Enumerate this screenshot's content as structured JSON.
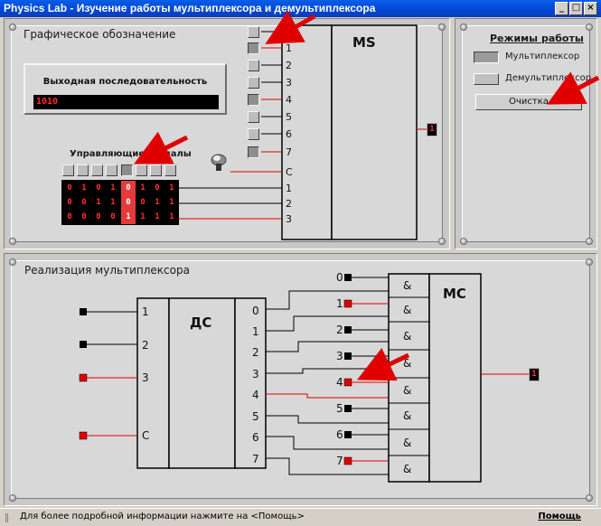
{
  "window": {
    "title": "Physics Lab - Изучение работы мультиплексора и демультиплексора",
    "min": "_",
    "max": "□",
    "close": "×"
  },
  "top_panel": {
    "title": "Графическое обозначение",
    "output_box_title": "Выходная последовательность",
    "output_value": "1010",
    "control_title": "Управляющие сигналы",
    "control_grid": [
      [
        "0",
        "1",
        "0",
        "1",
        "0",
        "1",
        "0",
        "1"
      ],
      [
        "0",
        "0",
        "1",
        "1",
        "0",
        "0",
        "1",
        "1"
      ],
      [
        "0",
        "0",
        "0",
        "0",
        "1",
        "1",
        "1",
        "1"
      ]
    ],
    "highlight_column": 4,
    "ms": {
      "title": "MS",
      "inputs": [
        "0",
        "1",
        "2",
        "3",
        "4",
        "5",
        "6",
        "7"
      ],
      "control_labels": [
        "C",
        "1",
        "2",
        "3"
      ],
      "c_value": "4",
      "output_value": "1"
    }
  },
  "modes": {
    "title": "Режимы работы",
    "mux": "Мультиплексор",
    "demux": "Демультиплексор",
    "clear": "Очистка"
  },
  "bottom_panel": {
    "title": "Реализация мультиплексора",
    "dc_title": "ДС",
    "dc_inputs": [
      "1",
      "2",
      "3",
      "C"
    ],
    "dc_outputs": [
      "0",
      "1",
      "2",
      "3",
      "4",
      "5",
      "6",
      "7"
    ],
    "and_label": "&",
    "mc_title": "МС",
    "input_labels": [
      "0",
      "1",
      "2",
      "3",
      "4",
      "5",
      "6",
      "7"
    ],
    "output_value": "1"
  },
  "statusbar": {
    "text": "Для более подробной информации нажмите на <Помощь>",
    "help": "Помощь"
  },
  "colors": {
    "red_wire": "#e00000",
    "title_blue": "#0a5ee8",
    "arrow_red": "#e00000"
  }
}
